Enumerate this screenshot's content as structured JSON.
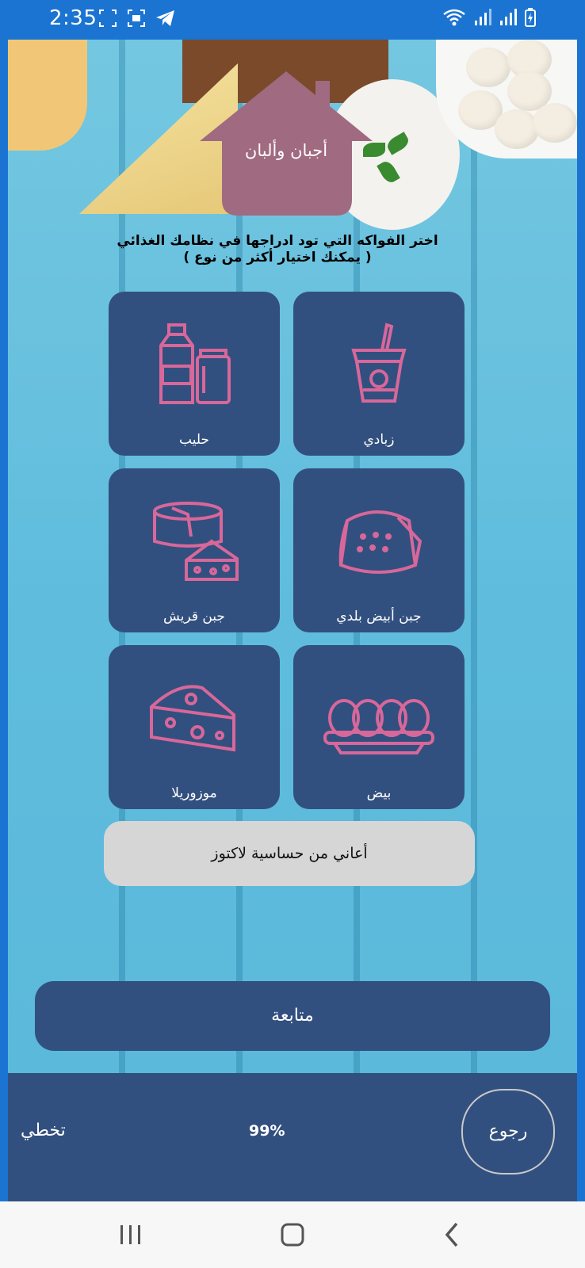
{
  "status_bar": {
    "time": "2:35"
  },
  "header": {
    "title": "أجبان وألبان"
  },
  "instruction": {
    "line1": "اختر الفواكه التي تود ادراجها في نظامك الغذائي",
    "line2": "( يمكنك اختيار أكثر من نوع )"
  },
  "cards": [
    {
      "label": "حليب",
      "icon": "milk-carton-icon"
    },
    {
      "label": "زبادي",
      "icon": "yogurt-cup-icon"
    },
    {
      "label": "جبن قريش",
      "icon": "cheese-wheel-icon"
    },
    {
      "label": "جبن أبيض بلدي",
      "icon": "white-cheese-icon"
    },
    {
      "label": "موزوريلا",
      "icon": "swiss-cheese-icon"
    },
    {
      "label": "بيض",
      "icon": "eggs-tray-icon"
    }
  ],
  "lactose_button": "أعاني من حساسية لاكتوز",
  "continue_button": "متابعة",
  "bottom_bar": {
    "skip": "تخطي",
    "progress": "99%",
    "back": "رجوع"
  },
  "colors": {
    "card": "#32507f",
    "icon_stroke": "#d8679a",
    "house": "#a06a80",
    "status_bar": "#1b74d2"
  }
}
